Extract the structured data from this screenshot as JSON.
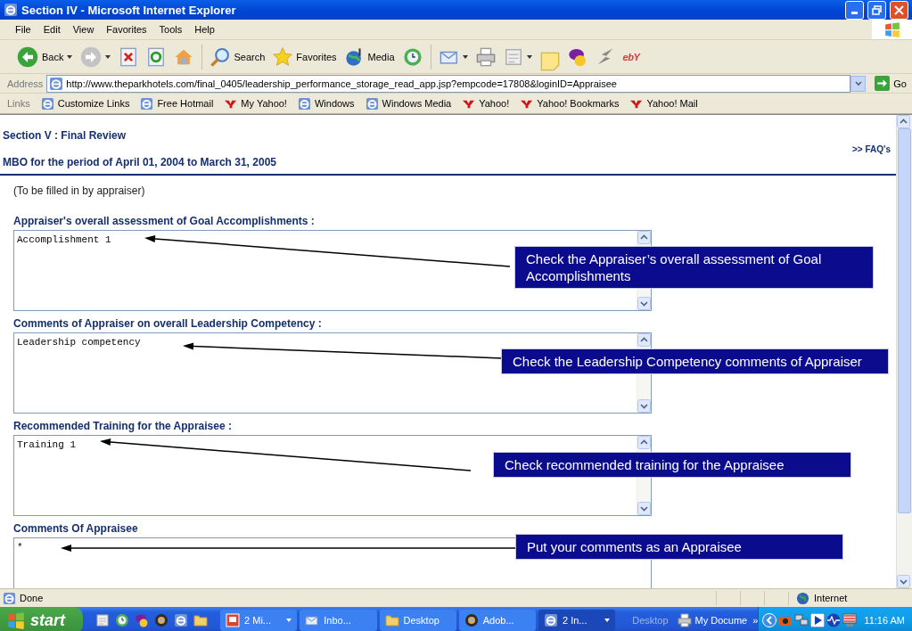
{
  "window": {
    "title": "Section IV - Microsoft Internet Explorer"
  },
  "menu": [
    "File",
    "Edit",
    "View",
    "Favorites",
    "Tools",
    "Help"
  ],
  "toolbar": [
    {
      "kind": "back",
      "label": "Back",
      "dropdown": true
    },
    {
      "kind": "forward",
      "dropdown": true
    },
    {
      "kind": "stop",
      "dropdown": false
    },
    {
      "kind": "refresh",
      "dropdown": false
    },
    {
      "kind": "home",
      "dropdown": false
    },
    {
      "kind": "sep"
    },
    {
      "kind": "search",
      "label": "Search",
      "dropdown": false
    },
    {
      "kind": "favorites",
      "label": "Favorites",
      "dropdown": false
    },
    {
      "kind": "media",
      "label": "Media",
      "dropdown": false
    },
    {
      "kind": "history",
      "dropdown": false
    },
    {
      "kind": "sep"
    },
    {
      "kind": "mail",
      "dropdown": true
    },
    {
      "kind": "print",
      "dropdown": false
    },
    {
      "kind": "edit",
      "dropdown": true
    },
    {
      "kind": "note",
      "dropdown": false
    },
    {
      "kind": "messenger",
      "dropdown": false
    },
    {
      "kind": "swoosh",
      "dropdown": false
    },
    {
      "kind": "ebay",
      "label": "ebY"
    }
  ],
  "address": {
    "label": "Address",
    "url": "http://www.theparkhotels.com/final_0405/leadership_performance_storage_read_app.jsp?empcode=17808&loginID=Appraisee",
    "go": "Go"
  },
  "links": {
    "label": "Links",
    "items": [
      {
        "kind": "ie",
        "label": "Customize Links"
      },
      {
        "kind": "ie",
        "label": "Free Hotmail"
      },
      {
        "kind": "yahoo",
        "label": "My Yahoo!"
      },
      {
        "kind": "ie",
        "label": "Windows"
      },
      {
        "kind": "ie",
        "label": "Windows Media"
      },
      {
        "kind": "yahoo",
        "label": "Yahoo!"
      },
      {
        "kind": "yahoo",
        "label": "Yahoo! Bookmarks"
      },
      {
        "kind": "yahoo",
        "label": "Yahoo! Mail"
      }
    ]
  },
  "page": {
    "section": "Section V : Final Review",
    "period": "MBO for the period of April 01, 2004 to March 31, 2005",
    "faq": ">> FAQ's",
    "note": "(To be filled in by appraiser)",
    "fields": [
      {
        "label": "Appraiser's overall assessment of Goal Accomplishments :",
        "value": "Accomplishment 1"
      },
      {
        "label": "Comments of Appraiser on overall Leadership Competency :",
        "value": "Leadership competency"
      },
      {
        "label": "Recommended Training for the Appraisee :",
        "value": "Training 1"
      },
      {
        "label": "Comments Of Appraisee",
        "value": "*"
      }
    ],
    "callouts": [
      {
        "text": "Check the Appraiser’s overall assessment of Goal Accomplishments"
      },
      {
        "text": "Check the Leadership Competency comments of Appraiser"
      },
      {
        "text": "Check recommended training for the Appraisee"
      },
      {
        "text": "Put your comments as an Appraisee"
      }
    ]
  },
  "status_bar": {
    "text": "Done",
    "zone": "Internet"
  },
  "taskbar": {
    "start": "start",
    "tasks": [
      {
        "kind": "presentation",
        "label": "2 Mi...",
        "grouped": true,
        "selected": false
      },
      {
        "kind": "mail",
        "label": "Inbo...",
        "grouped": false,
        "selected": false
      },
      {
        "kind": "folder",
        "label": "Desktop",
        "grouped": false,
        "selected": false
      },
      {
        "kind": "app",
        "label": "Adob...",
        "grouped": false,
        "selected": false
      },
      {
        "kind": "ie",
        "label": "2 In...",
        "grouped": true,
        "selected": true
      }
    ],
    "desktop_toolbar": {
      "label": "Desktop",
      "item": "My Docume",
      "more": "»"
    },
    "clock": "11:16 AM"
  }
}
